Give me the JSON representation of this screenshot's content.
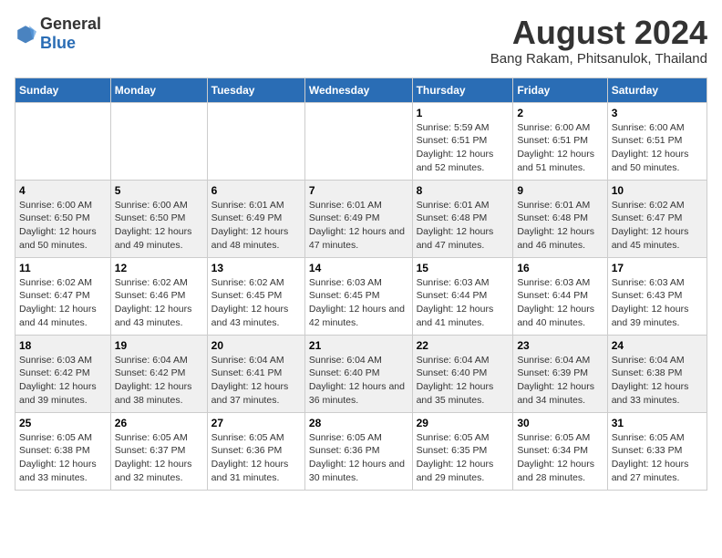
{
  "logo": {
    "general": "General",
    "blue": "Blue"
  },
  "title": "August 2024",
  "subtitle": "Bang Rakam, Phitsanulok, Thailand",
  "days_of_week": [
    "Sunday",
    "Monday",
    "Tuesday",
    "Wednesday",
    "Thursday",
    "Friday",
    "Saturday"
  ],
  "weeks": [
    [
      {
        "num": "",
        "info": ""
      },
      {
        "num": "",
        "info": ""
      },
      {
        "num": "",
        "info": ""
      },
      {
        "num": "",
        "info": ""
      },
      {
        "num": "1",
        "info": "Sunrise: 5:59 AM\nSunset: 6:51 PM\nDaylight: 12 hours and 52 minutes."
      },
      {
        "num": "2",
        "info": "Sunrise: 6:00 AM\nSunset: 6:51 PM\nDaylight: 12 hours and 51 minutes."
      },
      {
        "num": "3",
        "info": "Sunrise: 6:00 AM\nSunset: 6:51 PM\nDaylight: 12 hours and 50 minutes."
      }
    ],
    [
      {
        "num": "4",
        "info": "Sunrise: 6:00 AM\nSunset: 6:50 PM\nDaylight: 12 hours and 50 minutes."
      },
      {
        "num": "5",
        "info": "Sunrise: 6:00 AM\nSunset: 6:50 PM\nDaylight: 12 hours and 49 minutes."
      },
      {
        "num": "6",
        "info": "Sunrise: 6:01 AM\nSunset: 6:49 PM\nDaylight: 12 hours and 48 minutes."
      },
      {
        "num": "7",
        "info": "Sunrise: 6:01 AM\nSunset: 6:49 PM\nDaylight: 12 hours and 47 minutes."
      },
      {
        "num": "8",
        "info": "Sunrise: 6:01 AM\nSunset: 6:48 PM\nDaylight: 12 hours and 47 minutes."
      },
      {
        "num": "9",
        "info": "Sunrise: 6:01 AM\nSunset: 6:48 PM\nDaylight: 12 hours and 46 minutes."
      },
      {
        "num": "10",
        "info": "Sunrise: 6:02 AM\nSunset: 6:47 PM\nDaylight: 12 hours and 45 minutes."
      }
    ],
    [
      {
        "num": "11",
        "info": "Sunrise: 6:02 AM\nSunset: 6:47 PM\nDaylight: 12 hours and 44 minutes."
      },
      {
        "num": "12",
        "info": "Sunrise: 6:02 AM\nSunset: 6:46 PM\nDaylight: 12 hours and 43 minutes."
      },
      {
        "num": "13",
        "info": "Sunrise: 6:02 AM\nSunset: 6:45 PM\nDaylight: 12 hours and 43 minutes."
      },
      {
        "num": "14",
        "info": "Sunrise: 6:03 AM\nSunset: 6:45 PM\nDaylight: 12 hours and 42 minutes."
      },
      {
        "num": "15",
        "info": "Sunrise: 6:03 AM\nSunset: 6:44 PM\nDaylight: 12 hours and 41 minutes."
      },
      {
        "num": "16",
        "info": "Sunrise: 6:03 AM\nSunset: 6:44 PM\nDaylight: 12 hours and 40 minutes."
      },
      {
        "num": "17",
        "info": "Sunrise: 6:03 AM\nSunset: 6:43 PM\nDaylight: 12 hours and 39 minutes."
      }
    ],
    [
      {
        "num": "18",
        "info": "Sunrise: 6:03 AM\nSunset: 6:42 PM\nDaylight: 12 hours and 39 minutes."
      },
      {
        "num": "19",
        "info": "Sunrise: 6:04 AM\nSunset: 6:42 PM\nDaylight: 12 hours and 38 minutes."
      },
      {
        "num": "20",
        "info": "Sunrise: 6:04 AM\nSunset: 6:41 PM\nDaylight: 12 hours and 37 minutes."
      },
      {
        "num": "21",
        "info": "Sunrise: 6:04 AM\nSunset: 6:40 PM\nDaylight: 12 hours and 36 minutes."
      },
      {
        "num": "22",
        "info": "Sunrise: 6:04 AM\nSunset: 6:40 PM\nDaylight: 12 hours and 35 minutes."
      },
      {
        "num": "23",
        "info": "Sunrise: 6:04 AM\nSunset: 6:39 PM\nDaylight: 12 hours and 34 minutes."
      },
      {
        "num": "24",
        "info": "Sunrise: 6:04 AM\nSunset: 6:38 PM\nDaylight: 12 hours and 33 minutes."
      }
    ],
    [
      {
        "num": "25",
        "info": "Sunrise: 6:05 AM\nSunset: 6:38 PM\nDaylight: 12 hours and 33 minutes."
      },
      {
        "num": "26",
        "info": "Sunrise: 6:05 AM\nSunset: 6:37 PM\nDaylight: 12 hours and 32 minutes."
      },
      {
        "num": "27",
        "info": "Sunrise: 6:05 AM\nSunset: 6:36 PM\nDaylight: 12 hours and 31 minutes."
      },
      {
        "num": "28",
        "info": "Sunrise: 6:05 AM\nSunset: 6:36 PM\nDaylight: 12 hours and 30 minutes."
      },
      {
        "num": "29",
        "info": "Sunrise: 6:05 AM\nSunset: 6:35 PM\nDaylight: 12 hours and 29 minutes."
      },
      {
        "num": "30",
        "info": "Sunrise: 6:05 AM\nSunset: 6:34 PM\nDaylight: 12 hours and 28 minutes."
      },
      {
        "num": "31",
        "info": "Sunrise: 6:05 AM\nSunset: 6:33 PM\nDaylight: 12 hours and 27 minutes."
      }
    ]
  ]
}
